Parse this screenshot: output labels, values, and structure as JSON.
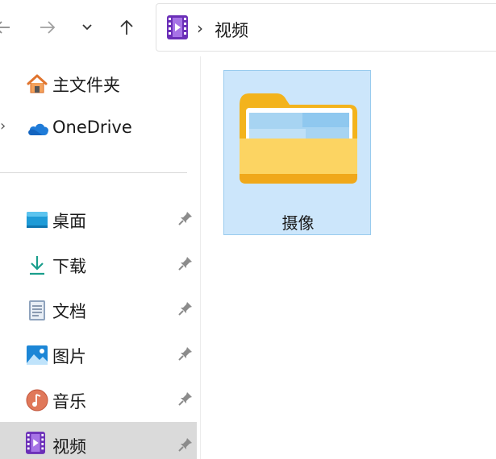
{
  "navigation": {
    "back_icon": "arrow-left-icon",
    "forward_icon": "arrow-right-icon",
    "recent_icon": "chevron-down-icon",
    "up_icon": "arrow-up-icon"
  },
  "address_bar": {
    "folder_icon": "video-folder-icon",
    "separator": "›",
    "breadcrumb": "视频"
  },
  "sidebar": {
    "top_items": [
      {
        "label": "主文件夹",
        "icon": "home-icon"
      },
      {
        "label": "OneDrive",
        "icon": "onedrive-cloud-icon",
        "expand_glyph": "›"
      }
    ],
    "quick_access": [
      {
        "label": "桌面",
        "icon": "desktop-icon",
        "pinned": true
      },
      {
        "label": "下载",
        "icon": "download-icon",
        "pinned": true
      },
      {
        "label": "文档",
        "icon": "document-icon",
        "pinned": true
      },
      {
        "label": "图片",
        "icon": "pictures-icon",
        "pinned": true
      },
      {
        "label": "音乐",
        "icon": "music-icon",
        "pinned": true
      },
      {
        "label": "视频",
        "icon": "video-icon",
        "pinned": true,
        "selected": true
      }
    ]
  },
  "content": {
    "items": [
      {
        "name": "摄像",
        "type": "folder",
        "selected": true
      }
    ]
  },
  "colors": {
    "selection_fill": "#cce6fb",
    "selection_border": "#99cbee",
    "sidebar_selected": "#dadada",
    "folder_yellow": "#fcd462",
    "video_purple": "#7a3fc4"
  }
}
